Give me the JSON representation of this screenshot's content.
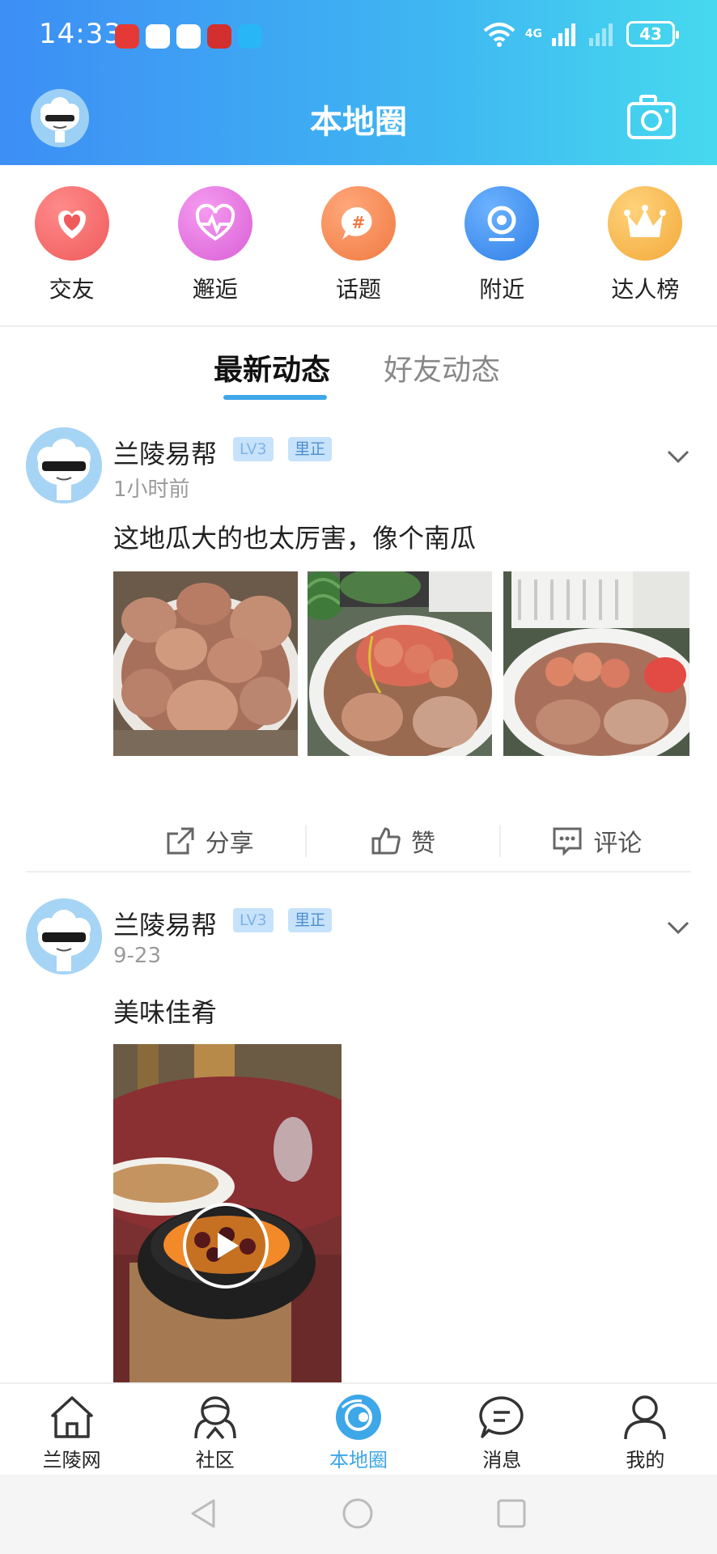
{
  "status_bar": {
    "time": "14:33",
    "network": "4G",
    "battery": "43"
  },
  "header": {
    "title": "本地圈"
  },
  "quick_entries": [
    {
      "label": "交友",
      "icon": "heart-icon",
      "color": "#f06b6b"
    },
    {
      "label": "邂逅",
      "icon": "heartbeat-icon",
      "color": "#e86ee0"
    },
    {
      "label": "话题",
      "icon": "topic-hash-icon",
      "color": "#f58a55"
    },
    {
      "label": "附近",
      "icon": "location-pin-icon",
      "color": "#3f8ef0"
    },
    {
      "label": "达人榜",
      "icon": "crown-icon",
      "color": "#f5b43f"
    }
  ],
  "tabs": {
    "latest": "最新动态",
    "friends": "好友动态"
  },
  "posts": [
    {
      "author": "兰陵易帮",
      "level": "LV3",
      "location": "里正",
      "time": "1小时前",
      "text": "这地瓜大的也太厉害，像个南瓜",
      "actions": {
        "share": "分享",
        "like": "赞",
        "comment": "评论"
      }
    },
    {
      "author": "兰陵易帮",
      "level": "LV3",
      "location": "里正",
      "time": "9-23",
      "text": "美味佳肴"
    }
  ],
  "bottom_nav": [
    {
      "label": "兰陵网",
      "icon": "home-icon"
    },
    {
      "label": "社区",
      "icon": "community-icon"
    },
    {
      "label": "本地圈",
      "icon": "local-circle-icon"
    },
    {
      "label": "消息",
      "icon": "message-icon"
    },
    {
      "label": "我的",
      "icon": "profile-icon"
    }
  ],
  "colors": {
    "accent": "#3ea7e8",
    "header_start": "#3d8ef5",
    "header_end": "#46d9ee"
  }
}
